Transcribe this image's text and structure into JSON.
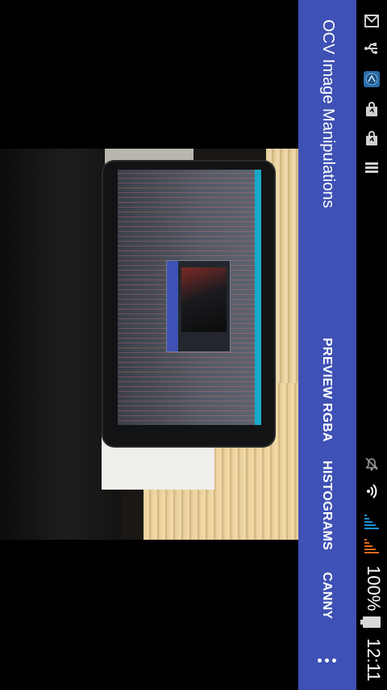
{
  "app": {
    "title": "OCV Image Manipulations",
    "accent_color": "#3f51b5"
  },
  "toolbar": {
    "actions": [
      {
        "label": "PREVIEW RGBA"
      },
      {
        "label": "HISTOGRAMS"
      },
      {
        "label": "CANNY"
      }
    ],
    "overflow_icon": "more-vert-icon"
  },
  "status_bar": {
    "time": "12:11",
    "battery_percent": "100%",
    "icons": [
      "gmail-icon",
      "usb-icon",
      "app-notification-icon",
      "shopping-bag-icon",
      "shopping-bag-icon",
      "storage-icon",
      "bell-off-icon",
      "wifi-icon",
      "signal-icon",
      "signal-icon",
      "battery-icon"
    ]
  },
  "camera_preview": {
    "label": "camera-preview"
  }
}
